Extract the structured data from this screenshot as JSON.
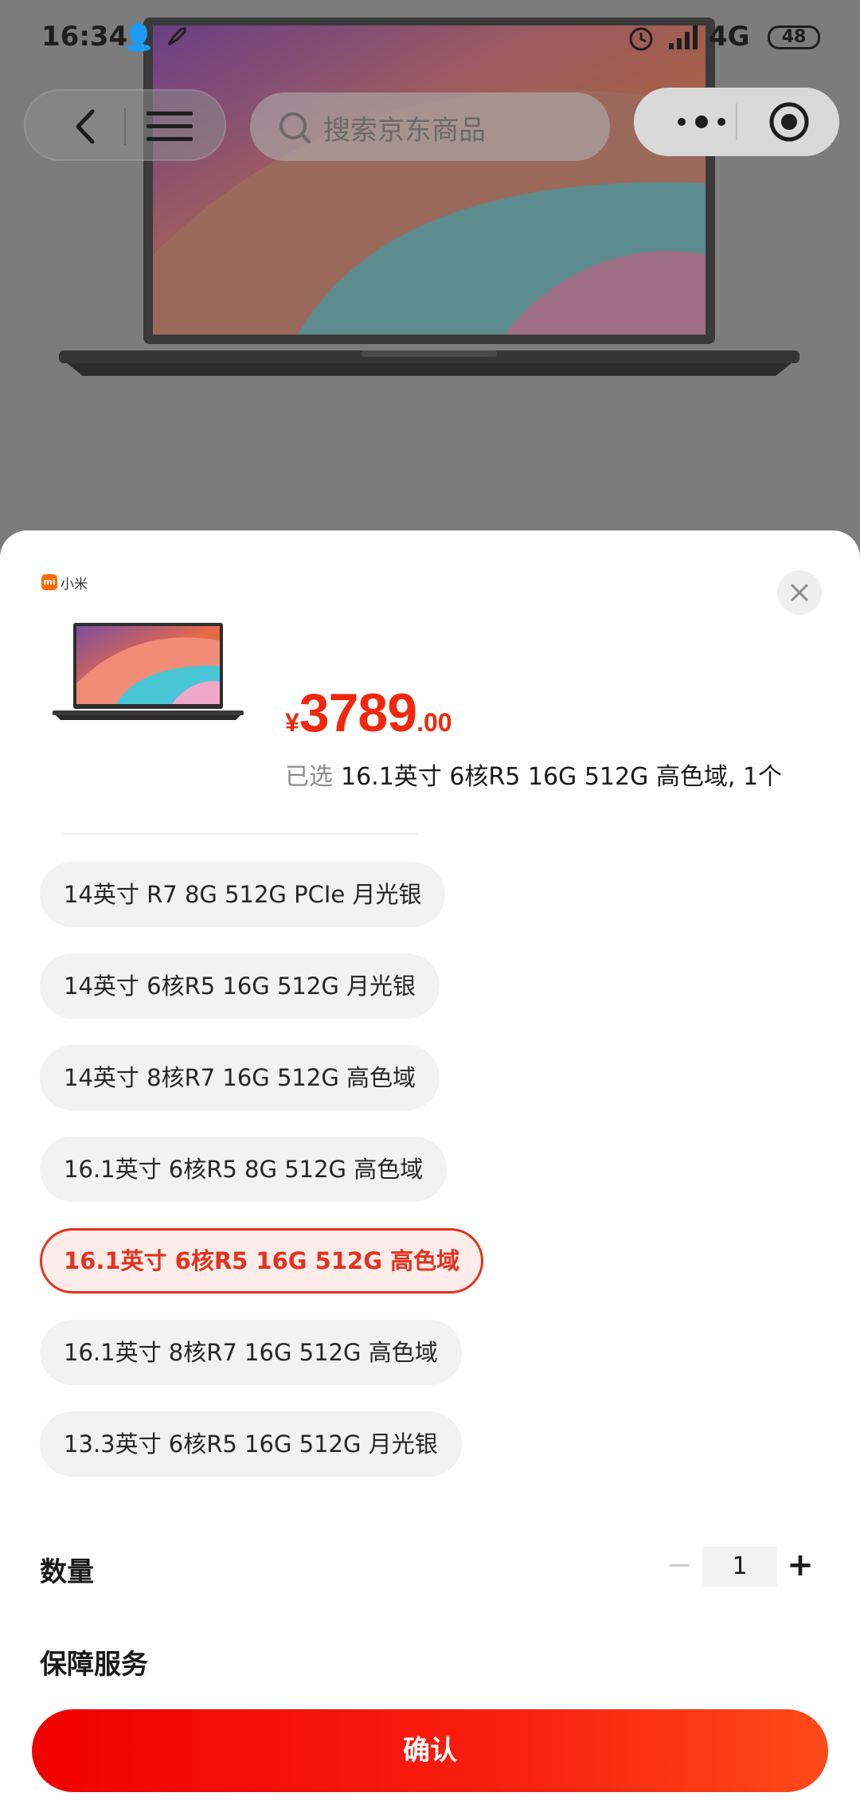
{
  "status_bar": {
    "time": "16:34",
    "network": "4G",
    "battery": "48"
  },
  "nav": {
    "search_placeholder": "搜索京东商品"
  },
  "product": {
    "brand": "小米",
    "brand_logo_text": "mi",
    "price_symbol": "¥",
    "price_integer": "3789",
    "price_decimal": ".00",
    "selected_label": "已选",
    "selected_value": "16.1英寸 6核R5 16G 512G 高色域, 1个"
  },
  "options": [
    {
      "label": "14英寸 R7 8G 512G PCIe 月光银",
      "selected": false
    },
    {
      "label": "14英寸 6核R5 16G 512G 月光银",
      "selected": false
    },
    {
      "label": "14英寸 8核R7 16G 512G 高色域",
      "selected": false
    },
    {
      "label": "16.1英寸 6核R5 8G 512G 高色域",
      "selected": false
    },
    {
      "label": "16.1英寸 6核R5 16G 512G 高色域",
      "selected": true
    },
    {
      "label": "16.1英寸 8核R7 16G 512G 高色域",
      "selected": false
    },
    {
      "label": "13.3英寸 6核R5 16G 512G 月光银",
      "selected": false
    }
  ],
  "quantity": {
    "label": "数量",
    "minus": "−",
    "value": "1",
    "plus": "+"
  },
  "service": {
    "label": "保障服务"
  },
  "confirm": {
    "label": "确认"
  },
  "colors": {
    "accent": "#e4321c",
    "price": "#f2270c",
    "button_start": "#f10000",
    "button_end": "#ff4a1a"
  }
}
